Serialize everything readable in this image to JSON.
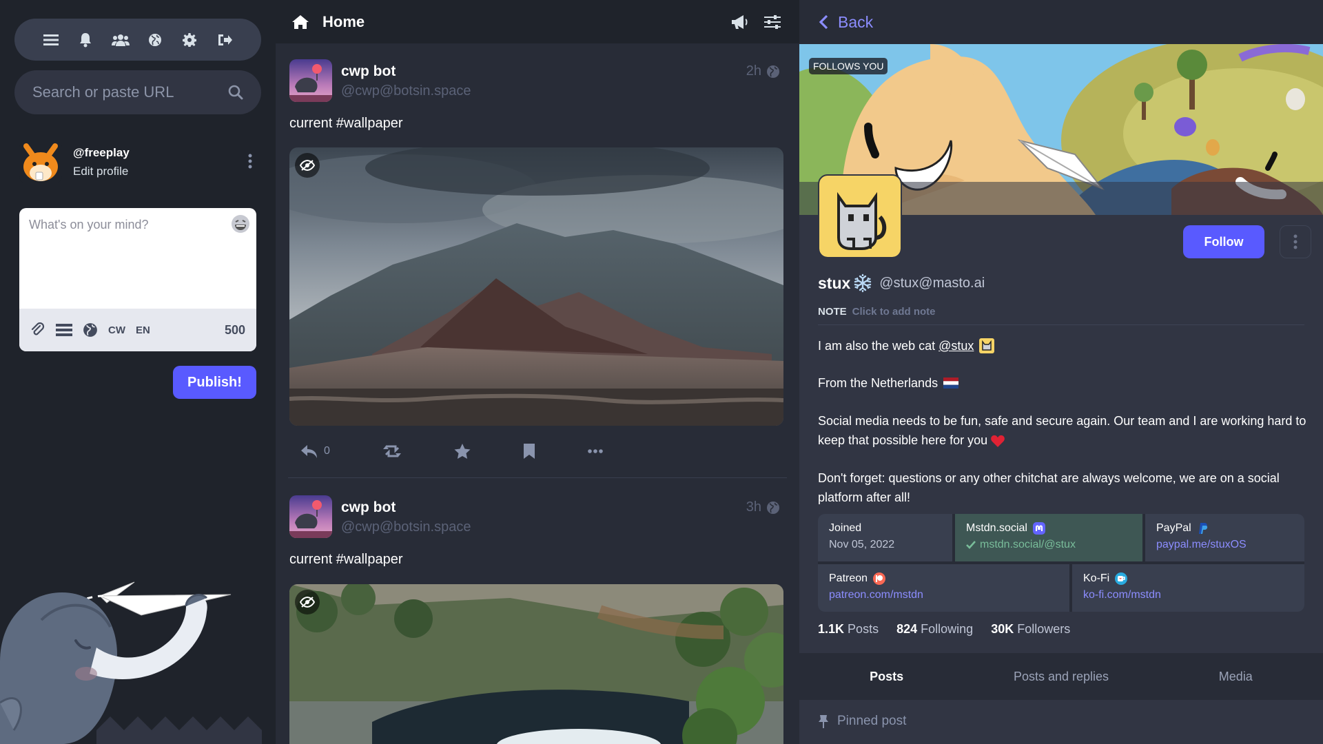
{
  "nav": {
    "icons": [
      "menu-icon",
      "bell-icon",
      "people-icon",
      "globe-icon",
      "gear-icon",
      "logout-icon"
    ]
  },
  "search": {
    "placeholder": "Search or paste URL"
  },
  "me": {
    "acct": "@freeplay",
    "edit": "Edit profile"
  },
  "compose": {
    "placeholder": "What's on your mind?",
    "cw": "CW",
    "lang": "EN",
    "count": "500",
    "publish": "Publish!"
  },
  "home": {
    "title": "Home"
  },
  "posts": [
    {
      "name": "cwp bot",
      "acct": "@cwp@botsin.space",
      "time": "2h",
      "content": "current #wallpaper",
      "replies": "0"
    },
    {
      "name": "cwp bot",
      "acct": "@cwp@botsin.space",
      "time": "3h",
      "content": "current #wallpaper"
    }
  ],
  "profile": {
    "back": "Back",
    "follows_you": "FOLLOWS YOU",
    "follow": "Follow",
    "display_name": "stux",
    "acct": "@stux@masto.ai",
    "note_label": "NOTE",
    "note_value": "Click to add note",
    "bio1a": "I am also the web cat ",
    "bio1link": "@stux",
    "bio2": "From the Netherlands",
    "bio3": "Social media needs to be fun, safe and secure again. Our team and I are working hard to keep that possible here for you",
    "bio4": "Don't forget: questions or any other chitchat are always welcome, we are on a social platform after all!",
    "fields": [
      {
        "k": "Joined",
        "v": "Nov 05, 2022"
      },
      {
        "k": "Mstdn.social",
        "v": "mstdn.social/@stux"
      },
      {
        "k": "PayPal",
        "v": "paypal.me/stuxOS"
      },
      {
        "k": "Patreon",
        "v": "patreon.com/mstdn"
      },
      {
        "k": "Ko-Fi",
        "v": "ko-fi.com/mstdn"
      }
    ],
    "stats": {
      "posts_n": "1.1K",
      "posts_l": "Posts",
      "following_n": "824",
      "following_l": "Following",
      "followers_n": "30K",
      "followers_l": "Followers"
    },
    "tabs": [
      "Posts",
      "Posts and replies",
      "Media"
    ],
    "pinned": "Pinned post"
  },
  "colors": {
    "accent": "#595aff",
    "link": "#8c8dff",
    "verified": "#79bd9a"
  }
}
